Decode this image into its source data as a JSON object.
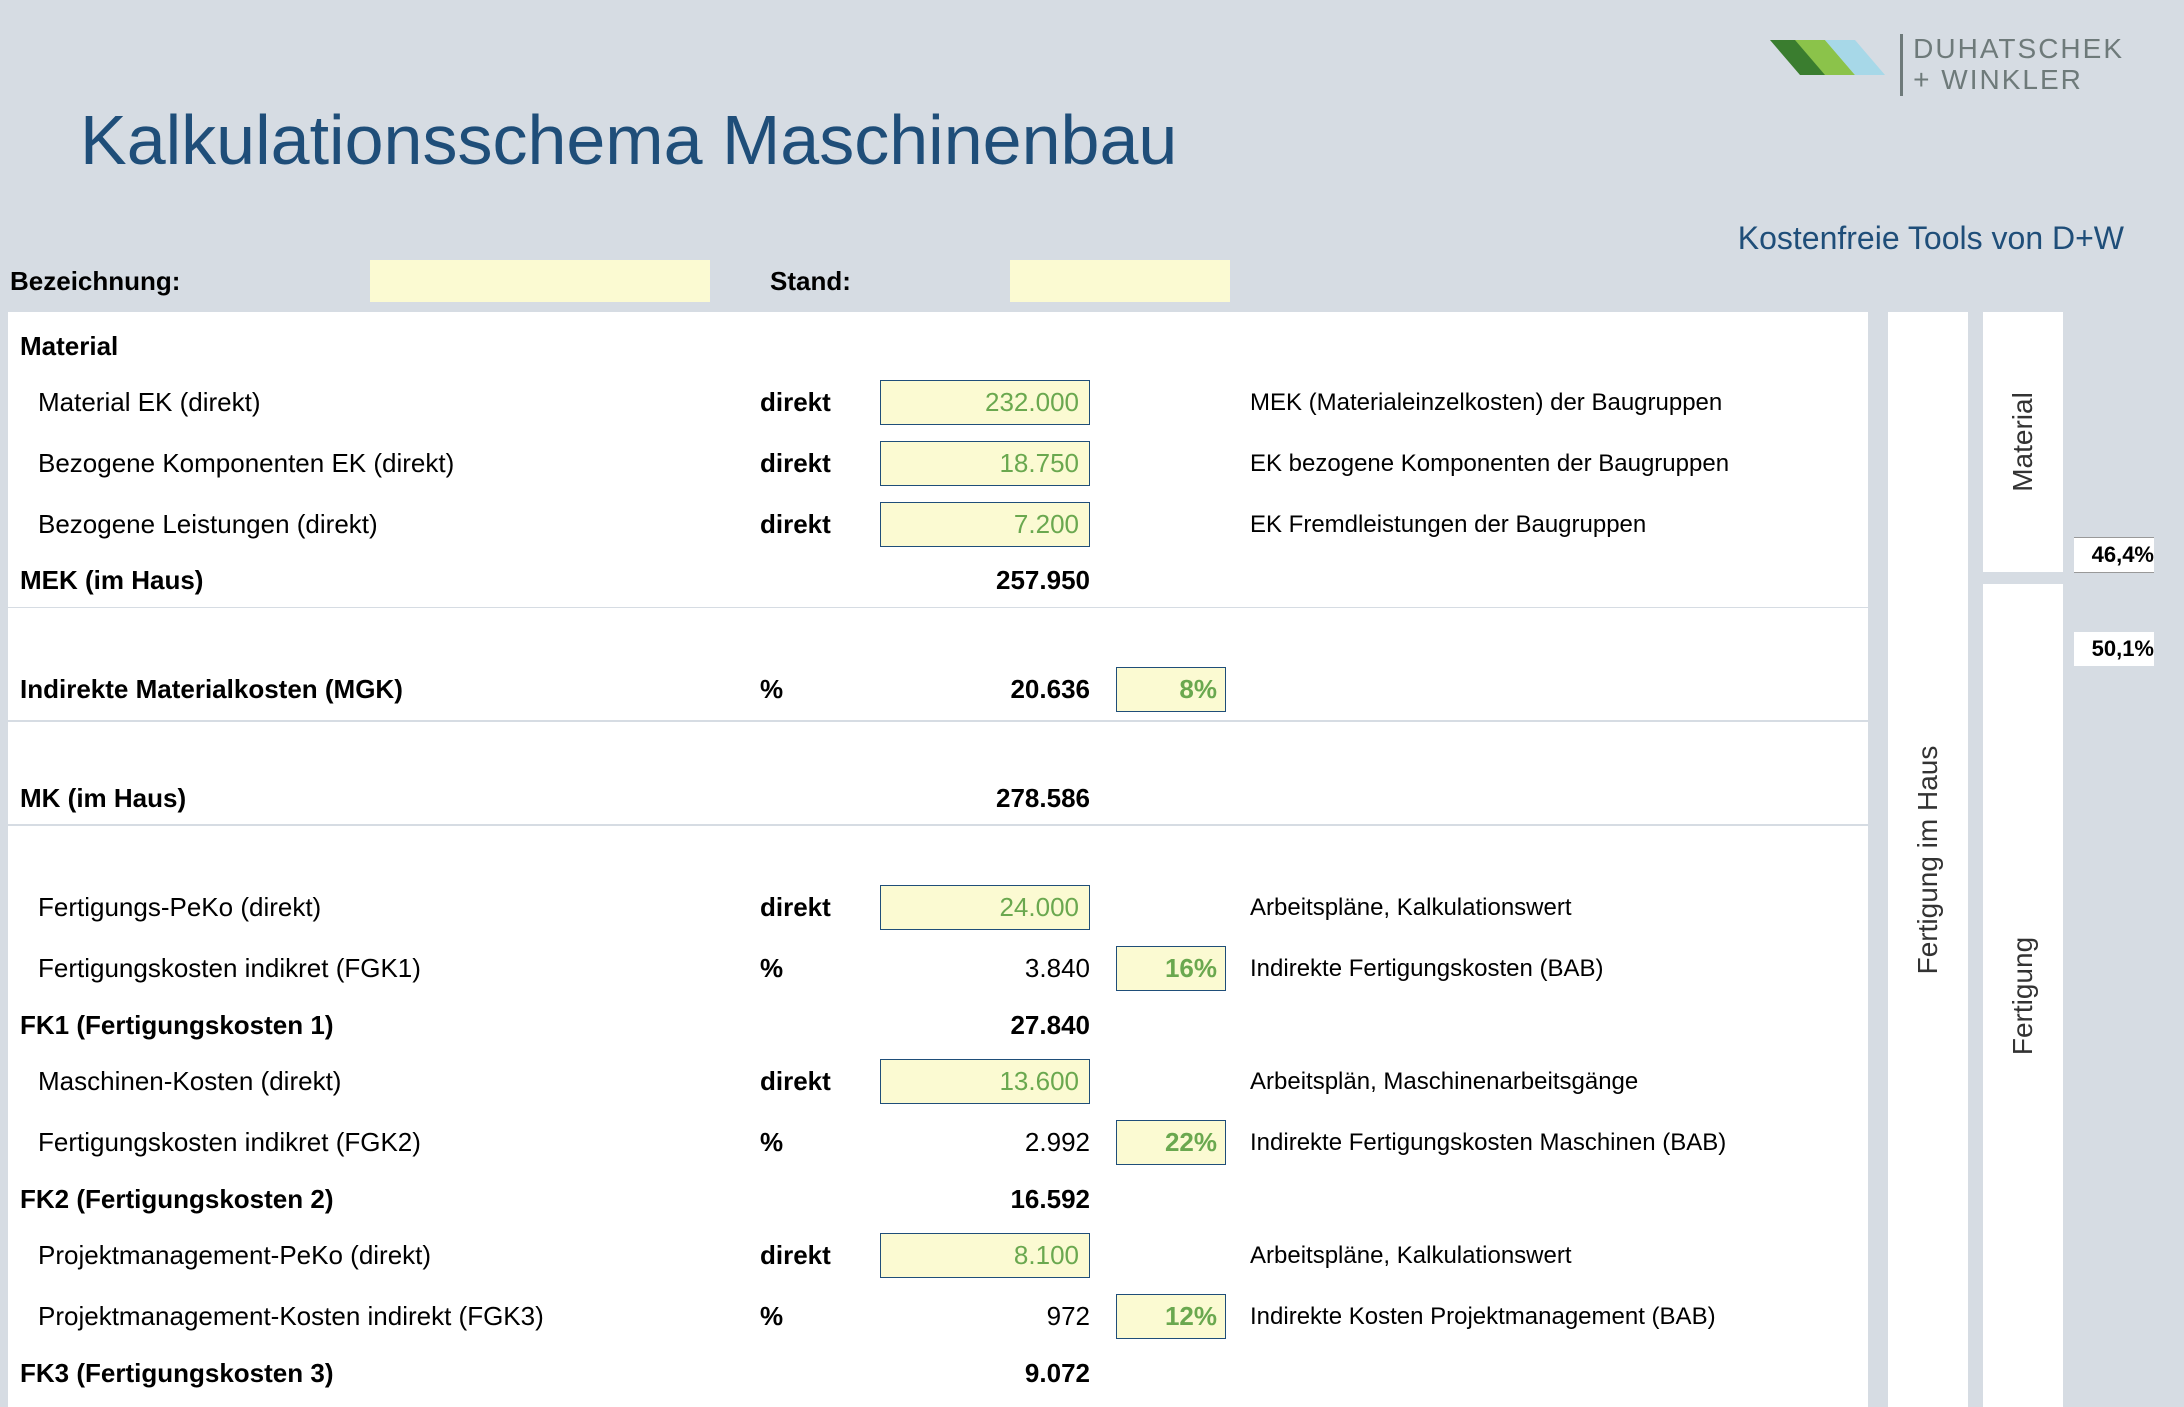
{
  "header": {
    "title": "Kalkulationsschema Maschinenbau",
    "brand_line1": "DUHATSCHEK",
    "brand_line2": "+ WINKLER",
    "tools_link": "Kostenfreie Tools von D+W"
  },
  "meta": {
    "label_bez": "Bezeichnung:",
    "val_bez": "",
    "label_stand": "Stand:",
    "val_stand": ""
  },
  "sections": {
    "material_head": "Material",
    "mek_sum_label": "MEK (im Haus)",
    "mek_sum_val": "257.950",
    "mgk_label": "Indirekte Materialkosten (MGK)",
    "mgk_type": "%",
    "mgk_val": "20.636",
    "mgk_pct": "8%",
    "mk_label": "MK  (im Haus)",
    "mk_val": "278.586",
    "fk1_label": "FK1 (Fertigungskosten 1)",
    "fk1_val": "27.840",
    "fk2_label": "FK2 (Fertigungskosten 2)",
    "fk2_val": "16.592",
    "fk3_label": "FK3 (Fertigungskosten 3)",
    "fk3_val": "9.072"
  },
  "rows": {
    "mat_ek": {
      "label": "Material EK (direkt)",
      "type": "direkt",
      "amt": "232.000",
      "note": "MEK (Materialeinzelkosten) der Baugruppen"
    },
    "komp_ek": {
      "label": "Bezogene Komponenten EK (direkt)",
      "type": "direkt",
      "amt": "18.750",
      "note": "EK bezogene Komponenten der Baugruppen"
    },
    "leist_ek": {
      "label": "Bezogene Leistungen (direkt)",
      "type": "direkt",
      "amt": "7.200",
      "note": "EK Fremdleistungen der Baugruppen"
    },
    "fert_peko": {
      "label": "Fertigungs-PeKo (direkt)",
      "type": "direkt",
      "amt": "24.000",
      "note": "Arbeitspläne, Kalkulationswert"
    },
    "fgk1": {
      "label": "Fertigungskosten indikret (FGK1)",
      "type": "%",
      "amt": "3.840",
      "pct": "16%",
      "note": "Indirekte Fertigungskosten (BAB)"
    },
    "masch": {
      "label": "Maschinen-Kosten (direkt)",
      "type": "direkt",
      "amt": "13.600",
      "note": "Arbeitsplän, Maschinenarbeitsgänge"
    },
    "fgk2": {
      "label": "Fertigungskosten indikret (FGK2)",
      "type": "%",
      "amt": "2.992",
      "pct": "22%",
      "note": "Indirekte Fertigungskosten Maschinen (BAB)"
    },
    "pm_peko": {
      "label": "Projektmanagement-PeKo (direkt)",
      "type": "direkt",
      "amt": "8.100",
      "note": "Arbeitspläne, Kalkulationswert"
    },
    "fgk3": {
      "label": "Projektmanagement-Kosten indirekt (FGK3)",
      "type": "%",
      "amt": "972",
      "pct": "12%",
      "note": "Indirekte Kosten Projektmanagement (BAB)"
    }
  },
  "side": {
    "fert_haus": "Fertigung im Haus",
    "material": "Material",
    "fertigung": "Fertigung",
    "pct_material": "46,4%",
    "pct_mk": "50,1%"
  }
}
